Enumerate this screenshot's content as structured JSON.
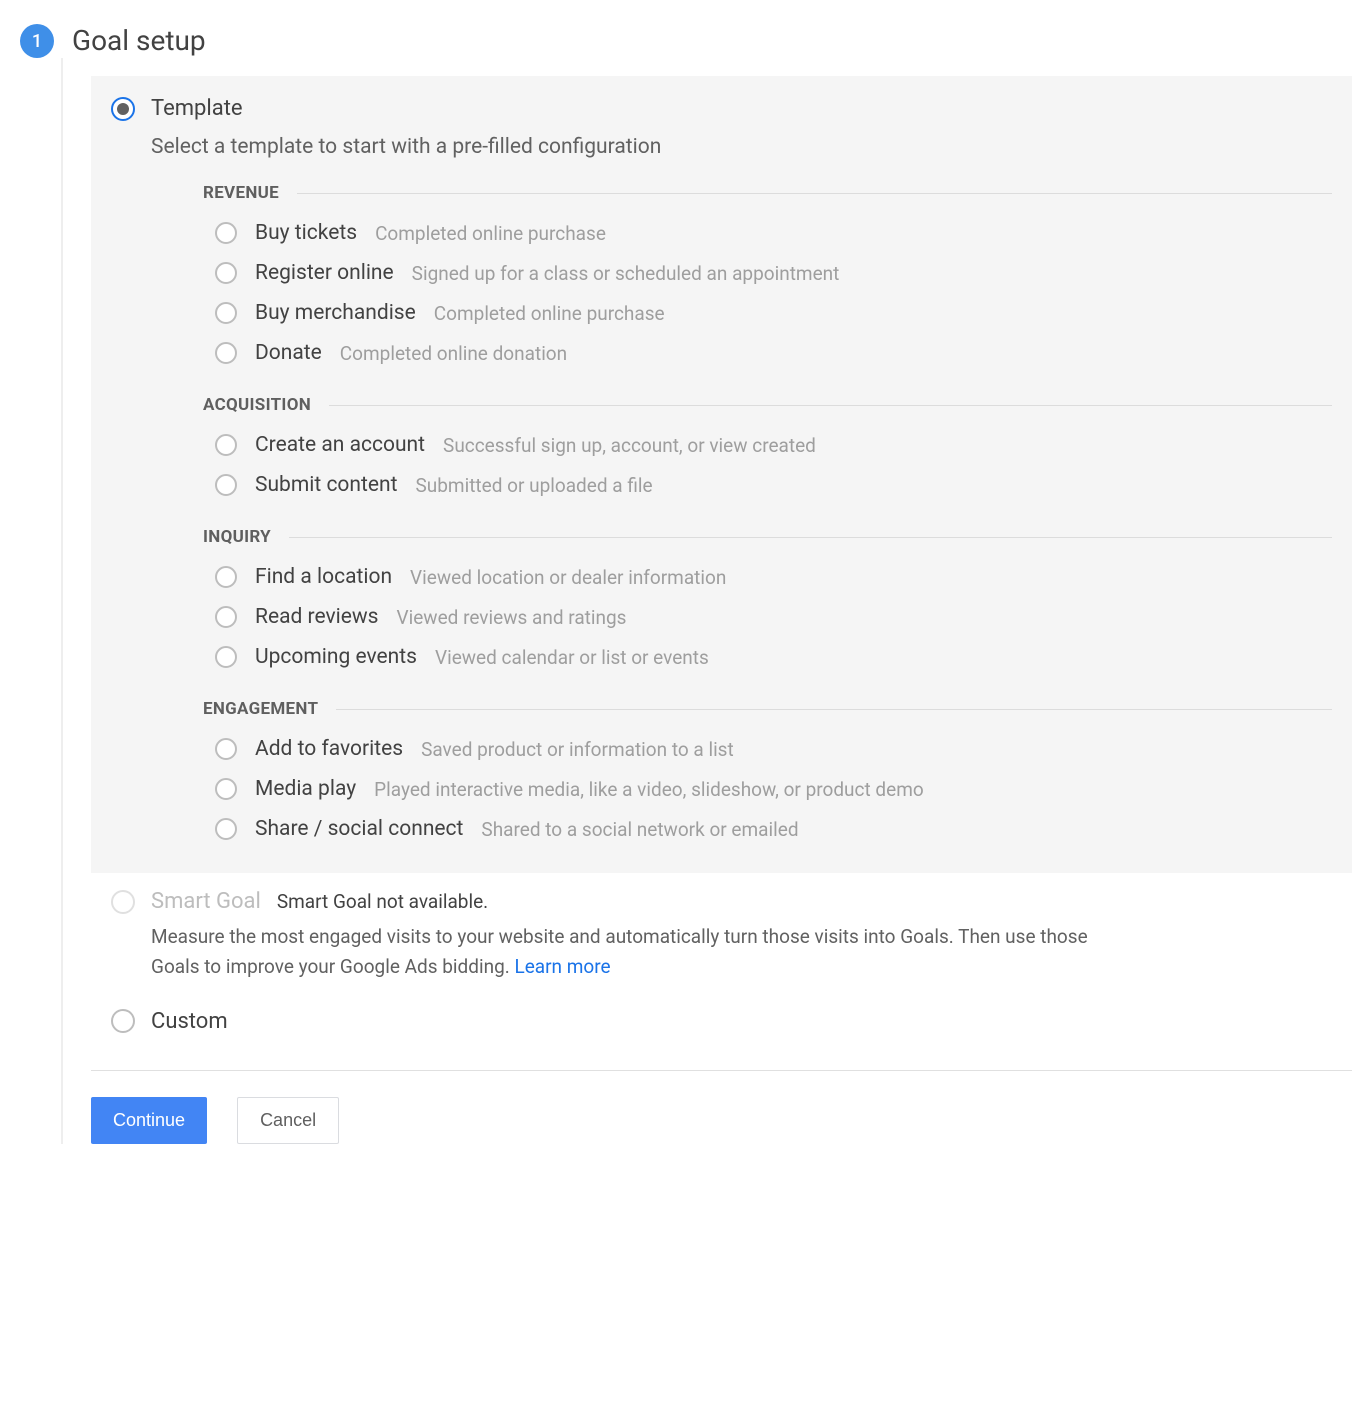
{
  "step": {
    "number": "1",
    "title": "Goal setup"
  },
  "template": {
    "label": "Template",
    "description": "Select a template to start with a pre-filled configuration"
  },
  "groups": {
    "revenue": {
      "title": "REVENUE",
      "items": {
        "buy_tickets": {
          "label": "Buy tickets",
          "desc": "Completed online purchase"
        },
        "register_online": {
          "label": "Register online",
          "desc": "Signed up for a class or scheduled an appointment"
        },
        "buy_merchandise": {
          "label": "Buy merchandise",
          "desc": "Completed online purchase"
        },
        "donate": {
          "label": "Donate",
          "desc": "Completed online donation"
        }
      }
    },
    "acquisition": {
      "title": "ACQUISITION",
      "items": {
        "create_account": {
          "label": "Create an account",
          "desc": "Successful sign up, account, or view created"
        },
        "submit_content": {
          "label": "Submit content",
          "desc": "Submitted or uploaded a file"
        }
      }
    },
    "inquiry": {
      "title": "INQUIRY",
      "items": {
        "find_location": {
          "label": "Find a location",
          "desc": "Viewed location or dealer information"
        },
        "read_reviews": {
          "label": "Read reviews",
          "desc": "Viewed reviews and ratings"
        },
        "upcoming_events": {
          "label": "Upcoming events",
          "desc": "Viewed calendar or list or events"
        }
      }
    },
    "engagement": {
      "title": "ENGAGEMENT",
      "items": {
        "add_favorites": {
          "label": "Add to favorites",
          "desc": "Saved product or information to a list"
        },
        "media_play": {
          "label": "Media play",
          "desc": "Played interactive media, like a video, slideshow, or product demo"
        },
        "share_social": {
          "label": "Share / social connect",
          "desc": "Shared to a social network or emailed"
        }
      }
    }
  },
  "smart_goal": {
    "label": "Smart Goal",
    "not_available": "Smart Goal not available.",
    "description": "Measure the most engaged visits to your website and automatically turn those visits into Goals. Then use those Goals to improve your Google Ads bidding. ",
    "learn_more": "Learn more"
  },
  "custom": {
    "label": "Custom"
  },
  "buttons": {
    "continue": "Continue",
    "cancel": "Cancel"
  }
}
